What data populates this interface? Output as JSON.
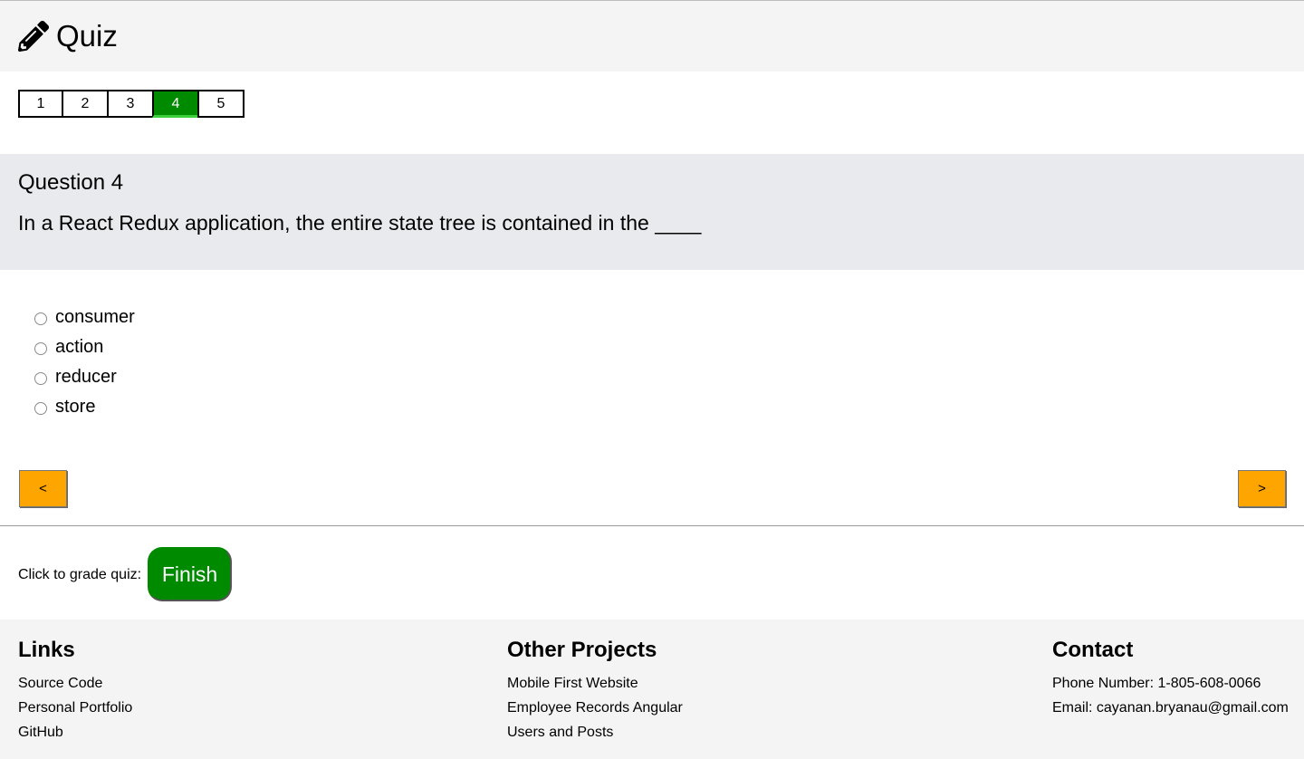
{
  "header": {
    "title": "Quiz",
    "icon": "pencil-icon"
  },
  "pager": {
    "pages": [
      "1",
      "2",
      "3",
      "4",
      "5"
    ],
    "active_index": 3
  },
  "question": {
    "number_label": "Question 4",
    "text": "In a React Redux application, the entire state tree is contained in the ____"
  },
  "options": [
    "consumer",
    "action",
    "reducer",
    "store"
  ],
  "nav": {
    "prev_label": "<",
    "next_label": ">"
  },
  "grade": {
    "label": "Click to grade quiz:",
    "finish_label": "Finish"
  },
  "footer": {
    "links": {
      "heading": "Links",
      "items": [
        "Source Code",
        "Personal Portfolio",
        "GitHub"
      ]
    },
    "projects": {
      "heading": "Other Projects",
      "items": [
        "Mobile First Website",
        "Employee Records Angular",
        "Users and Posts"
      ]
    },
    "contact": {
      "heading": "Contact",
      "phone": "Phone Number: 1-805-608-0066",
      "email": "Email: cayanan.bryanau@gmail.com"
    }
  },
  "colors": {
    "accent_green": "#008a00",
    "nav_orange": "#ffa500",
    "header_bg": "#f4f4f4",
    "question_bg": "#e9eaee"
  }
}
